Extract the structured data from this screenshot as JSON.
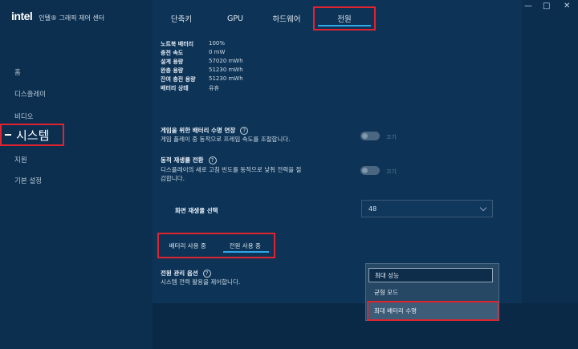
{
  "app": {
    "logo": "intel",
    "title": "인텔® 그래픽 제어 센터"
  },
  "window_controls": {
    "minimize": "—",
    "maximize": "□",
    "close": "✕"
  },
  "sidebar": {
    "items": [
      {
        "label": "홈"
      },
      {
        "label": "디스플레이"
      },
      {
        "label": "비디오"
      },
      {
        "label": "시스템",
        "active": true
      },
      {
        "label": "지원"
      },
      {
        "label": "기본 설정"
      }
    ]
  },
  "tabs": [
    {
      "label": "단축키"
    },
    {
      "label": "GPU"
    },
    {
      "label": "하드웨어"
    },
    {
      "label": "전원",
      "active": true
    }
  ],
  "battery_info": [
    {
      "key": "노트북 배터리",
      "value": "100%"
    },
    {
      "key": "충전 속도",
      "value": "0 mW"
    },
    {
      "key": "설계 용량",
      "value": "57020 mWh"
    },
    {
      "key": "완충 용량",
      "value": "51230 mWh"
    },
    {
      "key": "잔여 충전 용량",
      "value": "51230 mWh"
    },
    {
      "key": "배터리 상태",
      "value": "유휴"
    }
  ],
  "settings": {
    "gaming_battery": {
      "title": "게임을 위한 배터리 수명 연장",
      "desc": "게임 플레이 중 동적으로 프레임 속도를 조절합니다.",
      "toggle_label": "끄기",
      "enabled": false
    },
    "dynamic_refresh": {
      "title": "동적 재생률 전환",
      "desc_line1": "디스플레이의 새로 고침 빈도를 동적으로 낮춰 전력을 절",
      "desc_line2": "감합니다.",
      "toggle_label": "끄기",
      "enabled": false
    },
    "refresh_rate": {
      "label": "화면 재생율 선택",
      "value": "48"
    }
  },
  "subtabs": [
    {
      "label": "배터리 사용 중"
    },
    {
      "label": "전원 사용 중",
      "active": true
    }
  ],
  "power_options": {
    "title": "전원 관리 옵션",
    "desc": "시스템 전력 활용을 제어합니다.",
    "options": [
      {
        "label": "최대 성능"
      },
      {
        "label": "균형 모드"
      },
      {
        "label": "최대 배터리 수명",
        "highlighted": true
      }
    ]
  },
  "colors": {
    "highlight": "#e0242f",
    "accent": "#2fa7e8",
    "background": "#0d3356"
  }
}
